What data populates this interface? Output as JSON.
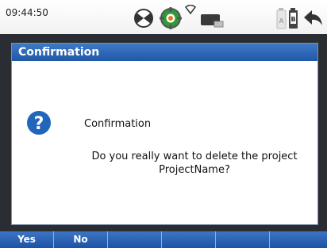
{
  "status_bar": {
    "time": "09:44:50",
    "icons": [
      "target-icon",
      "gps-satellite-icon",
      "wifi-icon",
      "device-icon",
      "battery-ab-icon",
      "back-arrow-icon"
    ]
  },
  "dialog": {
    "title": "Confirmation",
    "icon": "question-icon",
    "heading": "Confirmation",
    "message": "Do you really want to delete the project ProjectName?"
  },
  "softkeys": [
    "Yes",
    "No",
    "",
    "",
    "",
    ""
  ],
  "colors": {
    "title_bar": "#2a62b4",
    "softkey_bar": "#2a62b4",
    "frame": "#2a2d31",
    "question_icon": "#2266bb",
    "gps_green": "#2e9a3a"
  }
}
